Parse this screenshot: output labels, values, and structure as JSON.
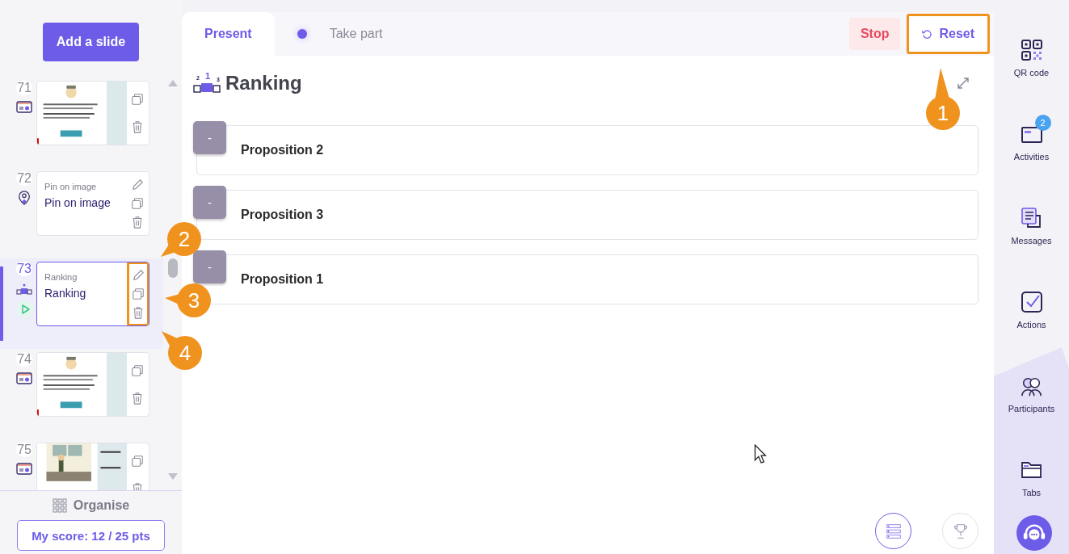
{
  "sidebar": {
    "add_button": "Add a slide",
    "slides": [
      {
        "number": "71",
        "kind": "slide",
        "selected": false,
        "highlighted": false
      },
      {
        "number": "72",
        "kind": "pin",
        "caption": "Pin on image",
        "title": "Pin on image",
        "selected": false,
        "highlighted": false
      },
      {
        "number": "73",
        "kind": "ranking",
        "caption": "Ranking",
        "title": "Ranking",
        "selected": true,
        "highlighted": true
      },
      {
        "number": "74",
        "kind": "slide",
        "selected": false,
        "highlighted": false
      },
      {
        "number": "75",
        "kind": "slide",
        "selected": false,
        "highlighted": false
      }
    ],
    "organise": "Organise",
    "score": "My score: 12 / 25 pts"
  },
  "tabs": [
    {
      "label": "Present",
      "selected": true,
      "live": false
    },
    {
      "label": "Take part",
      "selected": false,
      "live": true
    }
  ],
  "buttons": [
    {
      "kind": "stop",
      "label": "Stop",
      "highlighted": false
    },
    {
      "kind": "reset",
      "label": "Reset",
      "highlighted": true
    }
  ],
  "activity": {
    "title": "Ranking",
    "icon_numerals": [
      "2",
      "1",
      "3"
    ],
    "items": [
      {
        "rank": "-",
        "label": "Proposition 2"
      },
      {
        "rank": "-",
        "label": "Proposition 3"
      },
      {
        "rank": "-",
        "label": "Proposition 1"
      }
    ],
    "views": [
      {
        "kind": "list",
        "selected": true
      },
      {
        "kind": "trophy",
        "selected": false
      }
    ]
  },
  "rail": [
    {
      "kind": "qr",
      "label": "QR code"
    },
    {
      "kind": "activities",
      "label": "Activities",
      "badge": "2"
    },
    {
      "kind": "messages",
      "label": "Messages"
    },
    {
      "kind": "actions",
      "label": "Actions"
    },
    {
      "kind": "participants",
      "label": "Participants"
    },
    {
      "kind": "tabs",
      "label": "Tabs"
    }
  ],
  "callouts": [
    {
      "number": "1"
    },
    {
      "number": "2"
    },
    {
      "number": "3"
    },
    {
      "number": "4"
    }
  ]
}
